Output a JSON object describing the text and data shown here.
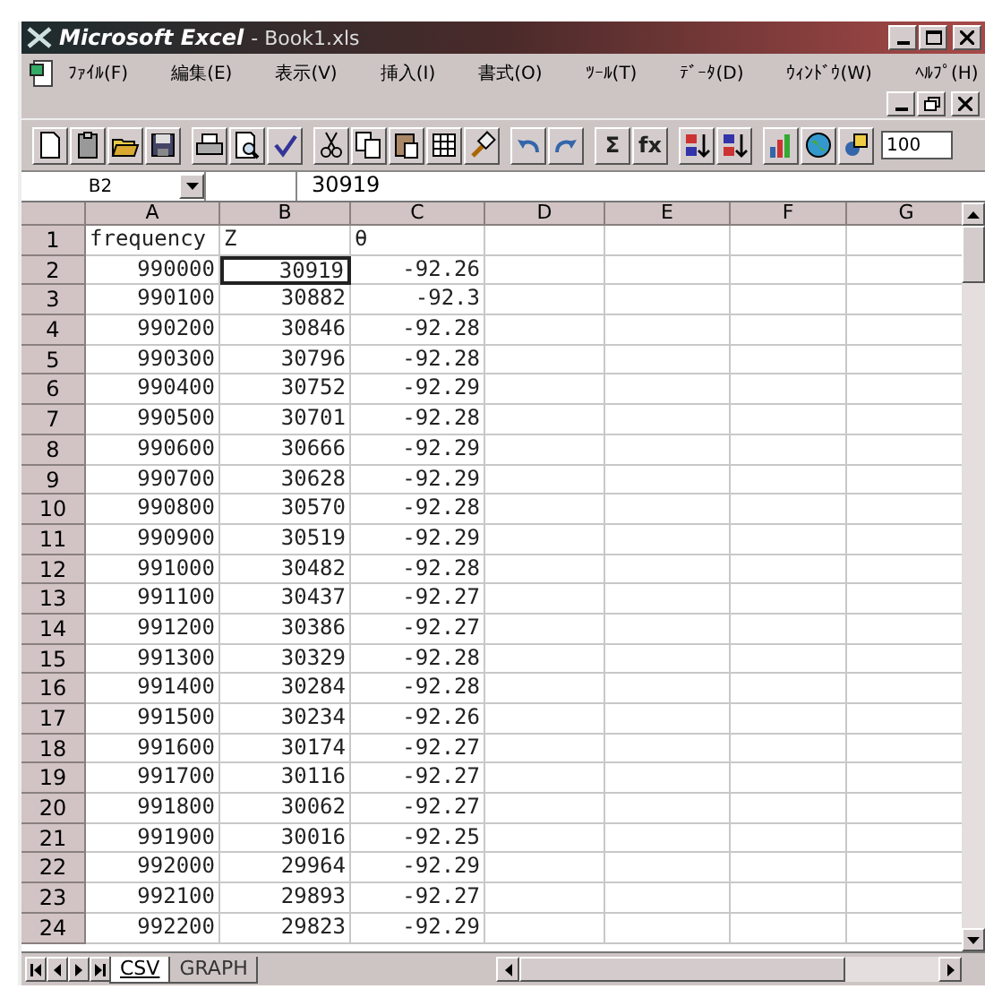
{
  "window": {
    "app_title": "Microsoft Excel",
    "doc_title": "- Book1.xls"
  },
  "menu": [
    "ﾌｧｲﾙ(F)",
    "編集(E)",
    "表示(V)",
    "挿入(I)",
    "書式(O)",
    "ﾂｰﾙ(T)",
    "ﾃﾞｰﾀ(D)",
    "ｳｨﾝﾄﾞｳ(W)",
    "ﾍﾙﾌﾟ(H)"
  ],
  "toolbar": {
    "autosum_label": "Σ",
    "function_label": "fx",
    "zoom": "100"
  },
  "formula_bar": {
    "name_box": "B2",
    "value": "30919"
  },
  "sheet": {
    "columns": [
      "A",
      "B",
      "C",
      "D",
      "E",
      "F",
      "G"
    ],
    "rows": [
      {
        "header": "1",
        "kind": "label",
        "cells": [
          {
            "text": "frequency",
            "selected": false
          },
          {
            "text": "Z",
            "selected": false
          },
          {
            "text": "θ",
            "selected": false
          }
        ]
      },
      {
        "header": "2",
        "kind": "number",
        "cells": [
          {
            "text": "990000",
            "selected": false
          },
          {
            "text": "30919",
            "selected": true
          },
          {
            "text": "-92.26",
            "selected": false
          }
        ]
      },
      {
        "header": "3",
        "kind": "number",
        "cells": [
          {
            "text": "990100",
            "selected": false
          },
          {
            "text": "30882",
            "selected": false
          },
          {
            "text": "-92.3",
            "selected": false
          }
        ]
      },
      {
        "header": "4",
        "kind": "number",
        "cells": [
          {
            "text": "990200",
            "selected": false
          },
          {
            "text": "30846",
            "selected": false
          },
          {
            "text": "-92.28",
            "selected": false
          }
        ]
      },
      {
        "header": "5",
        "kind": "number",
        "cells": [
          {
            "text": "990300",
            "selected": false
          },
          {
            "text": "30796",
            "selected": false
          },
          {
            "text": "-92.28",
            "selected": false
          }
        ]
      },
      {
        "header": "6",
        "kind": "number",
        "cells": [
          {
            "text": "990400",
            "selected": false
          },
          {
            "text": "30752",
            "selected": false
          },
          {
            "text": "-92.29",
            "selected": false
          }
        ]
      },
      {
        "header": "7",
        "kind": "number",
        "cells": [
          {
            "text": "990500",
            "selected": false
          },
          {
            "text": "30701",
            "selected": false
          },
          {
            "text": "-92.28",
            "selected": false
          }
        ]
      },
      {
        "header": "8",
        "kind": "number",
        "cells": [
          {
            "text": "990600",
            "selected": false
          },
          {
            "text": "30666",
            "selected": false
          },
          {
            "text": "-92.29",
            "selected": false
          }
        ]
      },
      {
        "header": "9",
        "kind": "number",
        "cells": [
          {
            "text": "990700",
            "selected": false
          },
          {
            "text": "30628",
            "selected": false
          },
          {
            "text": "-92.29",
            "selected": false
          }
        ]
      },
      {
        "header": "10",
        "kind": "number",
        "cells": [
          {
            "text": "990800",
            "selected": false
          },
          {
            "text": "30570",
            "selected": false
          },
          {
            "text": "-92.28",
            "selected": false
          }
        ]
      },
      {
        "header": "11",
        "kind": "number",
        "cells": [
          {
            "text": "990900",
            "selected": false
          },
          {
            "text": "30519",
            "selected": false
          },
          {
            "text": "-92.29",
            "selected": false
          }
        ]
      },
      {
        "header": "12",
        "kind": "number",
        "cells": [
          {
            "text": "991000",
            "selected": false
          },
          {
            "text": "30482",
            "selected": false
          },
          {
            "text": "-92.28",
            "selected": false
          }
        ]
      },
      {
        "header": "13",
        "kind": "number",
        "cells": [
          {
            "text": "991100",
            "selected": false
          },
          {
            "text": "30437",
            "selected": false
          },
          {
            "text": "-92.27",
            "selected": false
          }
        ]
      },
      {
        "header": "14",
        "kind": "number",
        "cells": [
          {
            "text": "991200",
            "selected": false
          },
          {
            "text": "30386",
            "selected": false
          },
          {
            "text": "-92.27",
            "selected": false
          }
        ]
      },
      {
        "header": "15",
        "kind": "number",
        "cells": [
          {
            "text": "991300",
            "selected": false
          },
          {
            "text": "30329",
            "selected": false
          },
          {
            "text": "-92.28",
            "selected": false
          }
        ]
      },
      {
        "header": "16",
        "kind": "number",
        "cells": [
          {
            "text": "991400",
            "selected": false
          },
          {
            "text": "30284",
            "selected": false
          },
          {
            "text": "-92.28",
            "selected": false
          }
        ]
      },
      {
        "header": "17",
        "kind": "number",
        "cells": [
          {
            "text": "991500",
            "selected": false
          },
          {
            "text": "30234",
            "selected": false
          },
          {
            "text": "-92.26",
            "selected": false
          }
        ]
      },
      {
        "header": "18",
        "kind": "number",
        "cells": [
          {
            "text": "991600",
            "selected": false
          },
          {
            "text": "30174",
            "selected": false
          },
          {
            "text": "-92.27",
            "selected": false
          }
        ]
      },
      {
        "header": "19",
        "kind": "number",
        "cells": [
          {
            "text": "991700",
            "selected": false
          },
          {
            "text": "30116",
            "selected": false
          },
          {
            "text": "-92.27",
            "selected": false
          }
        ]
      },
      {
        "header": "20",
        "kind": "number",
        "cells": [
          {
            "text": "991800",
            "selected": false
          },
          {
            "text": "30062",
            "selected": false
          },
          {
            "text": "-92.27",
            "selected": false
          }
        ]
      },
      {
        "header": "21",
        "kind": "number",
        "cells": [
          {
            "text": "991900",
            "selected": false
          },
          {
            "text": "30016",
            "selected": false
          },
          {
            "text": "-92.25",
            "selected": false
          }
        ]
      },
      {
        "header": "22",
        "kind": "number",
        "cells": [
          {
            "text": "992000",
            "selected": false
          },
          {
            "text": "29964",
            "selected": false
          },
          {
            "text": "-92.29",
            "selected": false
          }
        ]
      },
      {
        "header": "23",
        "kind": "number",
        "cells": [
          {
            "text": "992100",
            "selected": false
          },
          {
            "text": "29893",
            "selected": false
          },
          {
            "text": "-92.27",
            "selected": false
          }
        ]
      },
      {
        "header": "24",
        "kind": "number",
        "cells": [
          {
            "text": "992200",
            "selected": false
          },
          {
            "text": "29823",
            "selected": false
          },
          {
            "text": "-92.29",
            "selected": false
          }
        ]
      }
    ]
  },
  "sheet_tabs": [
    {
      "label": "CSV",
      "selected": true
    },
    {
      "label": "GRAPH",
      "selected": false
    }
  ]
}
